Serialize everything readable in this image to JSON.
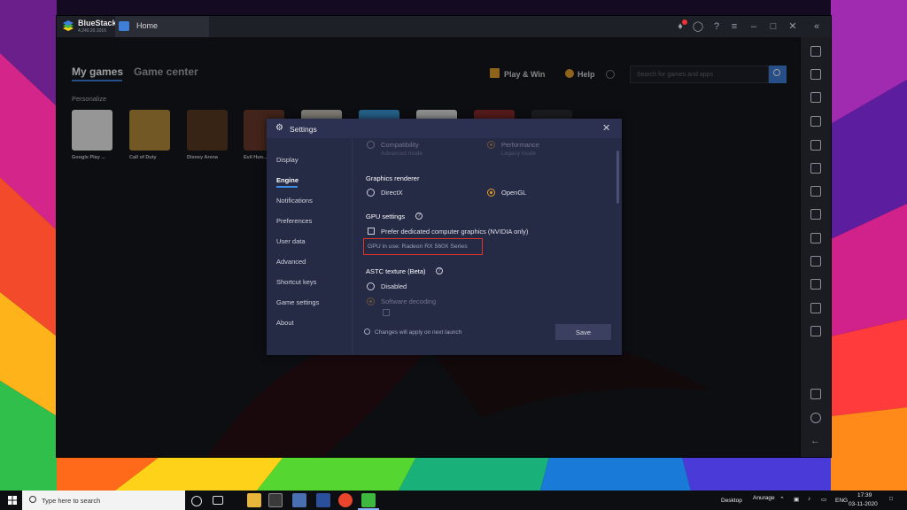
{
  "window": {
    "brand": "BlueStacks",
    "version": "4.240.20.1016",
    "tab_home": "Home"
  },
  "topnav": {
    "my_games": "My games",
    "game_center": "Game center",
    "play_win": "Play & Win",
    "help": "Help",
    "search_placeholder": "Search for games and apps"
  },
  "personalize": "Personalize",
  "games": [
    {
      "label": "Google Play ...",
      "color": "#f2f2f2"
    },
    {
      "label": "Call of Duty",
      "color": "#b98f3a"
    },
    {
      "label": "Disney Arena",
      "color": "#5a3a22"
    },
    {
      "label": "Evil Hun...",
      "color": "#6b3a2a"
    },
    {
      "label": "",
      "color": "#c9c3b8"
    },
    {
      "label": "",
      "color": "#3a9ad8"
    },
    {
      "label": "",
      "color": "#e6e6e6"
    },
    {
      "label": "",
      "color": "#8a2c2a"
    },
    {
      "label": "",
      "color": "#2b2d33"
    }
  ],
  "settings": {
    "title": "Settings",
    "nav": [
      "Display",
      "Engine",
      "Notifications",
      "Preferences",
      "User data",
      "Advanced",
      "Shortcut keys",
      "Game settings",
      "About"
    ],
    "active_nav": "Engine",
    "mode_compat": "Compatibility",
    "mode_compat_sub": "Advanced mode",
    "mode_perf": "Performance",
    "mode_perf_sub": "Legacy mode",
    "graphics_renderer": "Graphics renderer",
    "renderer_directx": "DirectX",
    "renderer_opengl": "OpenGL",
    "gpu_settings": "GPU settings",
    "prefer_dedicated": "Prefer dedicated computer graphics (NVIDIA only)",
    "gpu_in_use": "GPU in use: Radeon RX 560X Series",
    "astc": "ASTC texture (Beta)",
    "astc_disabled": "Disabled",
    "astc_software": "Software decoding",
    "note": "Changes will apply on next launch",
    "save": "Save"
  },
  "taskbar": {
    "search": "Type here to search",
    "desktop": "Desktop",
    "user": "Anurage",
    "lang": "ENG",
    "time": "17:39",
    "date": "03-11-2020"
  },
  "colors": {
    "accent": "#3f7fd8",
    "radio_selected": "#e8a02a",
    "highlight_box": "#e0312b"
  }
}
